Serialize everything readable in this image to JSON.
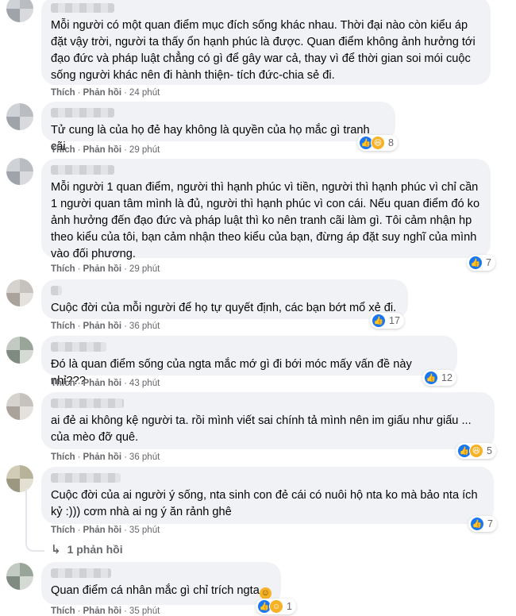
{
  "labels": {
    "like": "Thích",
    "reply": "Phản hồi"
  },
  "comments": [
    {
      "text": "Mỗi người có một quan điểm mục đích sống khác nhau. Thời đại nào còn kiểu áp đặt vậy trời, người ta thấy ổn hạnh phúc là được. Quan điểm không ảnh hưởng tới đạo đức và pháp luật chẳng có gì để gây war cả, thay vì để thời gian soi mói cuộc sống người khác nên đi hành thiện- tích đức-chia sẻ đi.",
      "time": "24 phút"
    },
    {
      "text": "Tử cung là của họ đẻ hay không là quyền của họ mắc gì tranh cãi",
      "time": "29 phút",
      "reaction_count": "8",
      "reaction_icons": [
        "like-icon",
        "haha-icon"
      ]
    },
    {
      "text": "Mỗi người 1 quan điểm, người thì hạnh phúc vì tiền, người thì hạnh phúc vì chỉ cần 1 người quan tâm mình là đủ, người thì hạnh phúc vì con cái. Nếu quan điểm đó ko ảnh hưởng đến đạo đức và pháp luật thì ko nên tranh cãi làm gì. Tôi cảm nhận hp theo kiểu của tôi, bạn cảm nhận theo kiểu của bạn, đừng áp đặt suy nghĩ của mình vào đối phương.",
      "time": "29 phút",
      "reaction_count": "7",
      "reaction_icons": [
        "like-icon"
      ]
    },
    {
      "text": "Cuộc đời của mỗi người để họ tự quyết định, các bạn bớt mổ xẻ đi.",
      "time": "36 phút",
      "reaction_count": "17",
      "reaction_icons": [
        "like-icon"
      ]
    },
    {
      "text": "Đó là quan điểm sống của ngta mắc mớ gì đi bới móc mấy vấn đề này nhỉ???",
      "time": "43 phút",
      "reaction_count": "12",
      "reaction_icons": [
        "like-icon"
      ]
    },
    {
      "text": "ai đẻ ai không kệ người ta. rồi mình viết sai chính tả mình nên im giấu như giấu ... của mèo đỡ quê.",
      "time": "36 phút",
      "reaction_count": "5",
      "reaction_icons": [
        "like-icon",
        "haha-icon"
      ]
    },
    {
      "text": "Cuộc đời của ai người ý sống, nta sinh con đẻ cái có nuôi hộ nta ko mà bảo nta ích kỷ :))) cơm nhà ai ng ý ăn rảnh ghê",
      "time": "35 phút",
      "reaction_count": "7",
      "reaction_icons": [
        "like-icon"
      ],
      "replies_label": "1 phản hồi"
    },
    {
      "text": "Quan điểm cá nhân mắc gì chỉ trích ngta",
      "time": "35 phút",
      "reaction_count": "1",
      "reaction_icons": [
        "like-icon",
        "smile-icon"
      ]
    }
  ],
  "colors": {
    "like": "#1877f2",
    "bubble": "#f0f2f5",
    "meta": "#65676b"
  }
}
